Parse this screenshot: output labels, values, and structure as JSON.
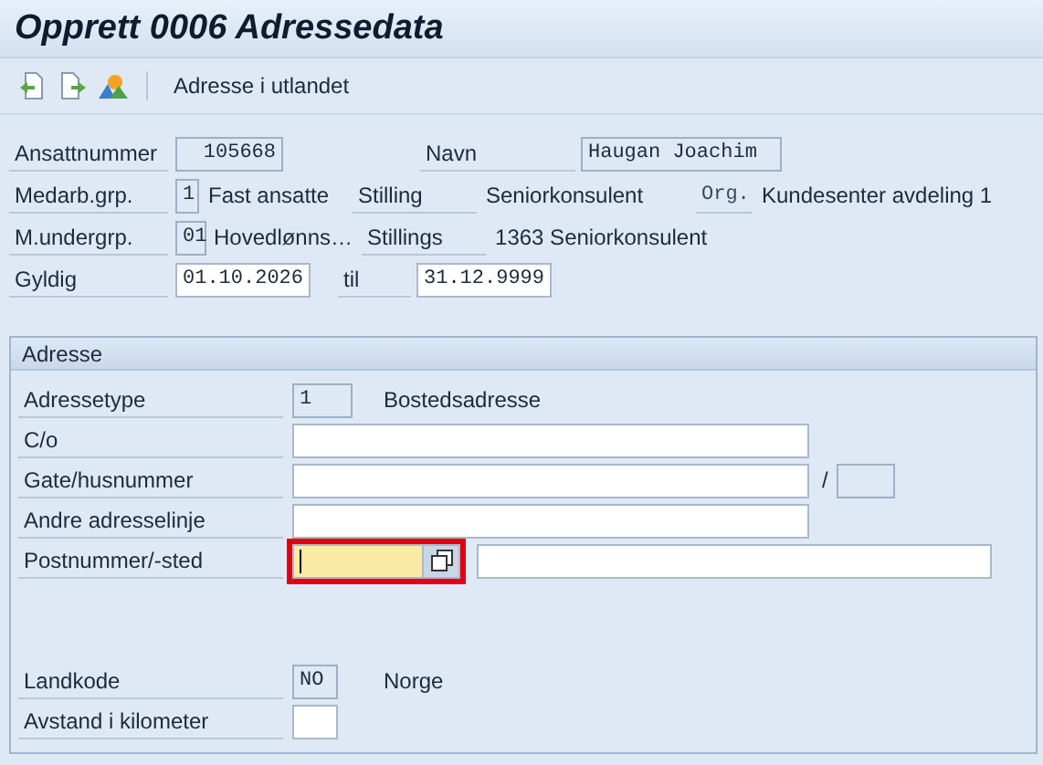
{
  "window": {
    "title": "Opprett 0006 Adressedata"
  },
  "toolbar": {
    "buttons": [
      {
        "label": "Adresse i utlandet"
      }
    ]
  },
  "header_rows": [
    [
      {
        "kind": "label",
        "text": "Ansattnummer"
      },
      {
        "kind": "field",
        "value": "105668",
        "readonly": true
      },
      {
        "kind": "label",
        "text": "Navn"
      },
      {
        "kind": "field",
        "value": "Haugan Joachim",
        "readonly": true
      }
    ],
    [
      {
        "kind": "label",
        "text": "Medarb.grp."
      },
      {
        "kind": "field",
        "value": "1",
        "readonly": true
      },
      {
        "kind": "text",
        "text": "Fast ansatte"
      },
      {
        "kind": "label",
        "text": "Stilling"
      },
      {
        "kind": "text",
        "text": "Seniorkonsulent"
      },
      {
        "kind": "code",
        "text": "Org."
      },
      {
        "kind": "text",
        "text": "Kundesenter avdeling 1"
      }
    ],
    [
      {
        "kind": "label",
        "text": "M.undergrp."
      },
      {
        "kind": "field",
        "value": "01",
        "readonly": true
      },
      {
        "kind": "text",
        "text": "Hovedlønns…"
      },
      {
        "kind": "label",
        "text": "Stillings"
      },
      {
        "kind": "text",
        "text": "1363 Seniorkonsulent"
      }
    ],
    [
      {
        "kind": "label",
        "text": "Gyldig"
      },
      {
        "kind": "field",
        "value": "01.10.2026",
        "readonly": false
      },
      {
        "kind": "label",
        "text": "til"
      },
      {
        "kind": "field",
        "value": "31.12.9999",
        "readonly": false
      }
    ]
  ],
  "address": {
    "title": "Adresse",
    "rows": [
      [
        {
          "kind": "label",
          "text": "Adressetype"
        },
        {
          "kind": "field",
          "value": "1",
          "readonly": true
        },
        {
          "kind": "text",
          "text": "Bostedsadresse"
        }
      ],
      [
        {
          "kind": "label",
          "text": "C/o"
        },
        {
          "kind": "field",
          "readonly": false
        }
      ],
      [
        {
          "kind": "label",
          "text": "Gate/husnummer"
        },
        {
          "kind": "field",
          "readonly": false
        },
        {
          "kind": "text",
          "text": "/"
        },
        {
          "kind": "field",
          "readonly": true
        }
      ],
      [
        {
          "kind": "label",
          "text": "Andre adresselinje"
        },
        {
          "kind": "field",
          "readonly": false
        }
      ],
      [
        {
          "kind": "label",
          "text": "Postnummer/-sted"
        },
        {
          "kind": "field",
          "readonly": false,
          "focused": true,
          "highlighted": true,
          "value_help": true
        },
        {
          "kind": "field",
          "readonly": false
        }
      ]
    ],
    "country_rows": [
      [
        {
          "kind": "label",
          "text": "Landkode"
        },
        {
          "kind": "field",
          "value": "NO",
          "readonly": true
        },
        {
          "kind": "text",
          "text": "Norge"
        }
      ],
      [
        {
          "kind": "label",
          "text": "Avstand i kilometer"
        },
        {
          "kind": "field",
          "readonly": false
        }
      ]
    ]
  }
}
